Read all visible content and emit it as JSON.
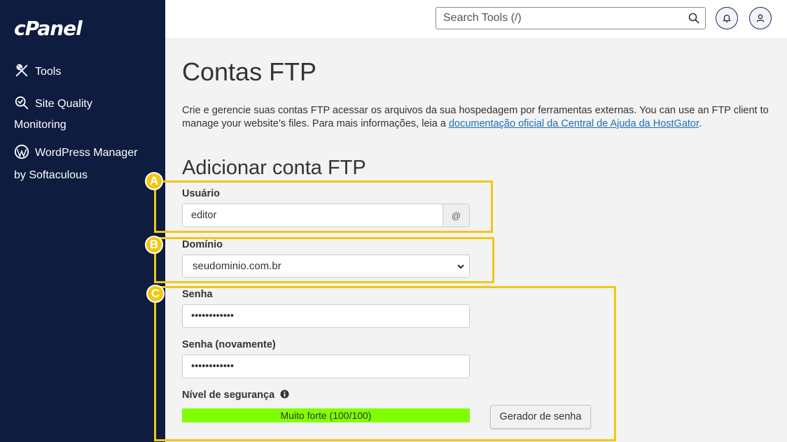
{
  "sidebar": {
    "logo": "cPanel",
    "items": [
      {
        "label": "Tools",
        "icon": "tools-icon"
      },
      {
        "label": "Site Quality Monitoring",
        "line1": "Site Quality",
        "line2": "Monitoring",
        "icon": "magnifier-check-icon"
      },
      {
        "label": "WordPress Manager by Softaculous",
        "line1": "WordPress Manager",
        "line2": "by Softaculous",
        "icon": "wordpress-icon"
      }
    ]
  },
  "header": {
    "search_placeholder": "Search Tools (/)",
    "icons": [
      "bell-icon",
      "user-icon"
    ]
  },
  "main": {
    "title": "Contas FTP",
    "description_before": "Crie e gerencie suas contas FTP acessar os arquivos da sua hospedagem por ferramentas externas. You can use an FTP client to manage your website’s files. Para mais informações, leia a ",
    "description_link": "documentação oficial da Central de Ajuda da HostGator",
    "description_after": ".",
    "section_title": "Adicionar conta FTP",
    "form": {
      "user_label": "Usuário",
      "user_value": "editor",
      "user_addon": "@",
      "domain_label": "Domínio",
      "domain_value": "seudominio.com.br",
      "password_label": "Senha",
      "password_value": "••••••••••••",
      "password_confirm_label": "Senha (novamente)",
      "password_confirm_value": "••••••••••••",
      "strength_label": "Nível de segurança",
      "strength_text": "Muito forte (100/100)",
      "strength_score": 100,
      "generator_button": "Gerador de senha"
    }
  },
  "annotations": {
    "badges": [
      "A",
      "B",
      "C"
    ],
    "color": "#f0c812"
  },
  "colors": {
    "sidebar_bg": "#0d1c3f",
    "strength_bar": "#80ff00",
    "link": "#1f6fb5"
  }
}
